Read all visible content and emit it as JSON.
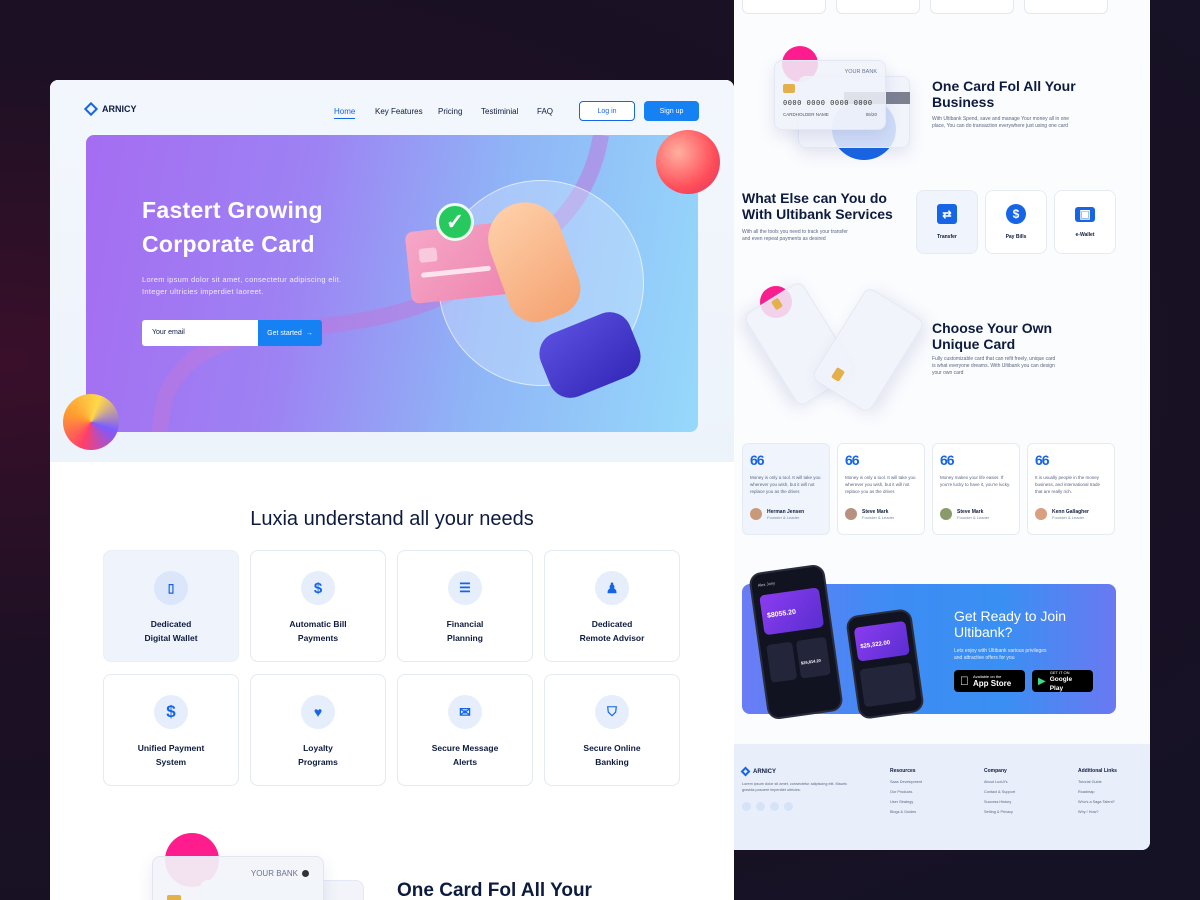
{
  "colors": {
    "primary": "#1565e6",
    "dark_text": "#0d1b3e",
    "backdrop": "#1c1024"
  },
  "left_page": {
    "brand": "ARNICY",
    "nav": [
      "Home",
      "Key Features",
      "Pricing",
      "Testiminial",
      "FAQ"
    ],
    "login_label": "Log in",
    "signup_label": "Sign up",
    "hero": {
      "title_line1": "Fastert Growing",
      "title_line2": "Corporate Card",
      "subtitle": "Lorem ipsum dolor sit amet, consectetur adipiscing elit. Integer ultricies imperdiet laoreet.",
      "email_placeholder": "Your email",
      "cta_label": "Get started",
      "arrow_icon": "arrow-right-icon"
    },
    "needs_title": "Luxia understand all your needs",
    "needs": [
      {
        "label": "Dedicated\nDigital Wallet",
        "icon": "phone-wallet-icon"
      },
      {
        "label": "Automatic Bill\nPayments",
        "icon": "dollar-circle-icon"
      },
      {
        "label": "Financial\nPlanning",
        "icon": "document-icon"
      },
      {
        "label": "Dedicated\nRemote Advisor",
        "icon": "advisor-icon"
      },
      {
        "label": "Unified Payment\nSystem",
        "icon": "dollar-icon"
      },
      {
        "label": "Loyalty\nPrograms",
        "icon": "hand-heart-icon"
      },
      {
        "label": "Secure Message\nAlerts",
        "icon": "envelope-icon"
      },
      {
        "label": "Secure Online\nBanking",
        "icon": "shield-dollar-icon"
      }
    ],
    "bottom_card_bank": "YOUR BANK",
    "bottom_heading": "One Card Fol All Your"
  },
  "right_page": {
    "card_bank": "YOUR BANK",
    "card_number": "0000 0000 0000 0000",
    "card_name": "CARDHOLDER NAME",
    "card_exp": "06/20",
    "one_card": {
      "title": "One Card Fol All Your Business",
      "text": "With Ultibank Spend, save and manage Your money all in one place, You can do transaction everywhere just using one card"
    },
    "services": {
      "title": "What Else can You do With Ultibank Services",
      "text": "With all the tools you need to track your transfer and even repeat payments as desired",
      "items": [
        {
          "label": "Transfer",
          "icon": "transfer-icon"
        },
        {
          "label": "Pay Bills",
          "icon": "dollar-circle-icon"
        },
        {
          "label": "e-Wallet",
          "icon": "wallet-icon"
        }
      ]
    },
    "unique": {
      "title": "Choose Your Own Unique Card",
      "text": "Fully customizable card that can refit freely, unique card is what everyone dreams. With Ultibank you can design your own card"
    },
    "testimonials": [
      {
        "text": "Money is only a tool. It will take you wherever you wish, but it will not replace you as the driver.",
        "name": "Herman Jensen",
        "role": "Founder & Leader"
      },
      {
        "text": "Money is only a tool. It will take you wherever you wish, but it will not replace you as the driver.",
        "name": "Steve Mark",
        "role": "Founder & Leader"
      },
      {
        "text": "Money makes your life easier. If you're lucky to have it, you're lucky.",
        "name": "Steve Mark",
        "role": "Founder & Leader"
      },
      {
        "text": "It is usually people in the money business, and international trade that are really rich.",
        "name": "Kenn Gallagher",
        "role": "Founder & Leader"
      }
    ],
    "cta": {
      "title": "Get Ready to Join Ultibank?",
      "text": "Lets enjoy with Ultibank various privileges and attractive offers for you",
      "app_store_small": "Available on the",
      "app_store": "App Store",
      "google_small": "GET IT ON",
      "google": "Google Play",
      "phone_greeting": "Alex Jony",
      "phone_balance": "$8055.20",
      "phone_balance2": "$25,322.00",
      "phone_value": "$26,814.20"
    },
    "footer": {
      "brand": "ARNICY",
      "text": "Lorem ipsum dolor sit amet, consectetur adipiscing elit. Mauris gravida posuere imperdiet ultricies.",
      "resources_title": "Resources",
      "resources": [
        "Saas Development",
        "Our Products",
        "User Strategy",
        "Blogs & Guides"
      ],
      "company_title": "Company",
      "company": [
        "About LuxUI's",
        "Contact & Support",
        "Success History",
        "Setting & Privacy"
      ],
      "links_title": "Additional Links",
      "links": [
        "Tutorial Guide",
        "Roadmap",
        "Who's a Saga Talent?",
        "Why / How?"
      ]
    }
  }
}
